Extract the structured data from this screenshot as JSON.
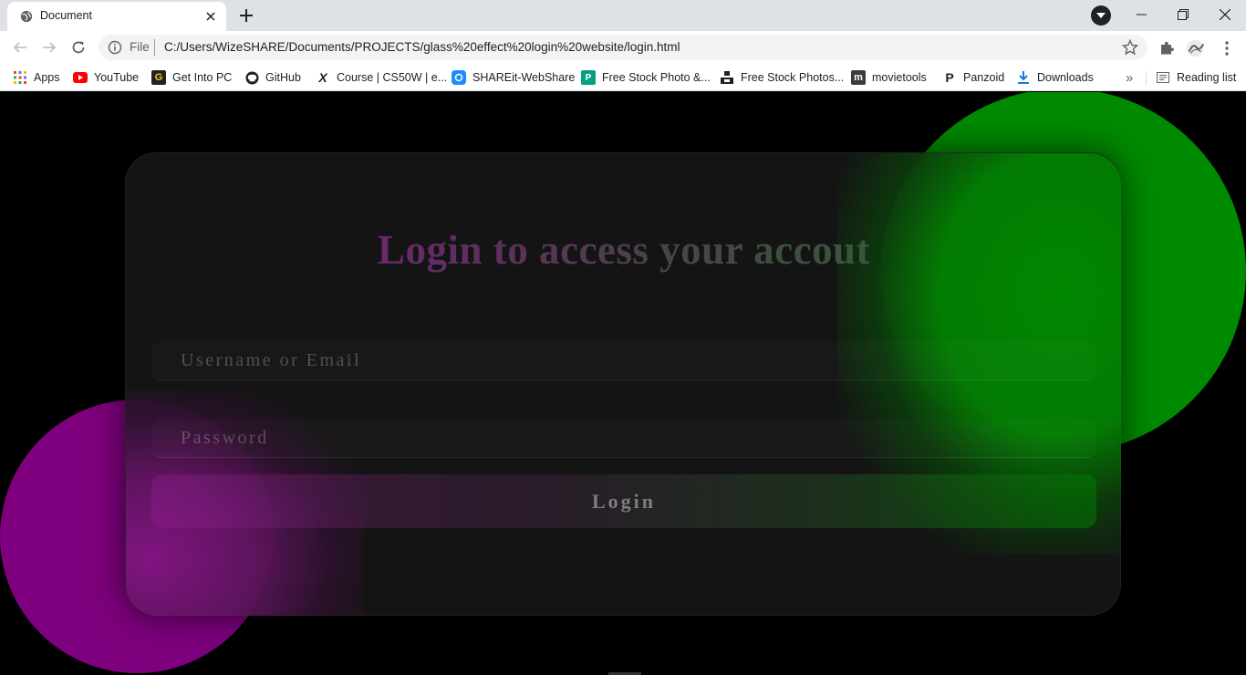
{
  "browser": {
    "tab_title": "Document",
    "url_scheme": "File",
    "url": "C:/Users/WizeSHARE/Documents/PROJECTS/glass%20effect%20login%20website/login.html",
    "bookmarks": [
      {
        "label": "Apps",
        "icon": "apps-grid-icon",
        "color": "#ea4335"
      },
      {
        "label": "YouTube",
        "icon": "youtube-icon",
        "color": "#ff0000"
      },
      {
        "label": "Get Into PC",
        "icon": "getintopc-icon",
        "color": "#202124"
      },
      {
        "label": "GitHub",
        "icon": "github-icon",
        "color": "#202124"
      },
      {
        "label": "Course | CS50W | e...",
        "icon": "edx-icon",
        "color": "#202124"
      },
      {
        "label": "SHAREit-WebShare",
        "icon": "shareit-icon",
        "color": "#1a8cff"
      },
      {
        "label": "Free Stock Photo &...",
        "icon": "stock-photo-icon",
        "color": "#05a081"
      },
      {
        "label": "Free Stock Photos...",
        "icon": "unsplash-icon",
        "color": "#202124"
      },
      {
        "label": "movietools",
        "icon": "movietools-icon",
        "color": "#3c3c3c"
      },
      {
        "label": "Panzoid",
        "icon": "panzoid-icon",
        "color": "#202124"
      },
      {
        "label": "Downloads",
        "icon": "download-icon",
        "color": "#1a73e8"
      }
    ],
    "more_bookmarks": "»",
    "reading_list": "Reading list"
  },
  "page": {
    "title": "Login to access your accout",
    "username_placeholder": "Username or Email",
    "password_placeholder": "Password",
    "login_label": "Login",
    "colors": {
      "background": "#000000",
      "green_circle": "#008a00",
      "purple_circle": "#7e007e"
    }
  }
}
